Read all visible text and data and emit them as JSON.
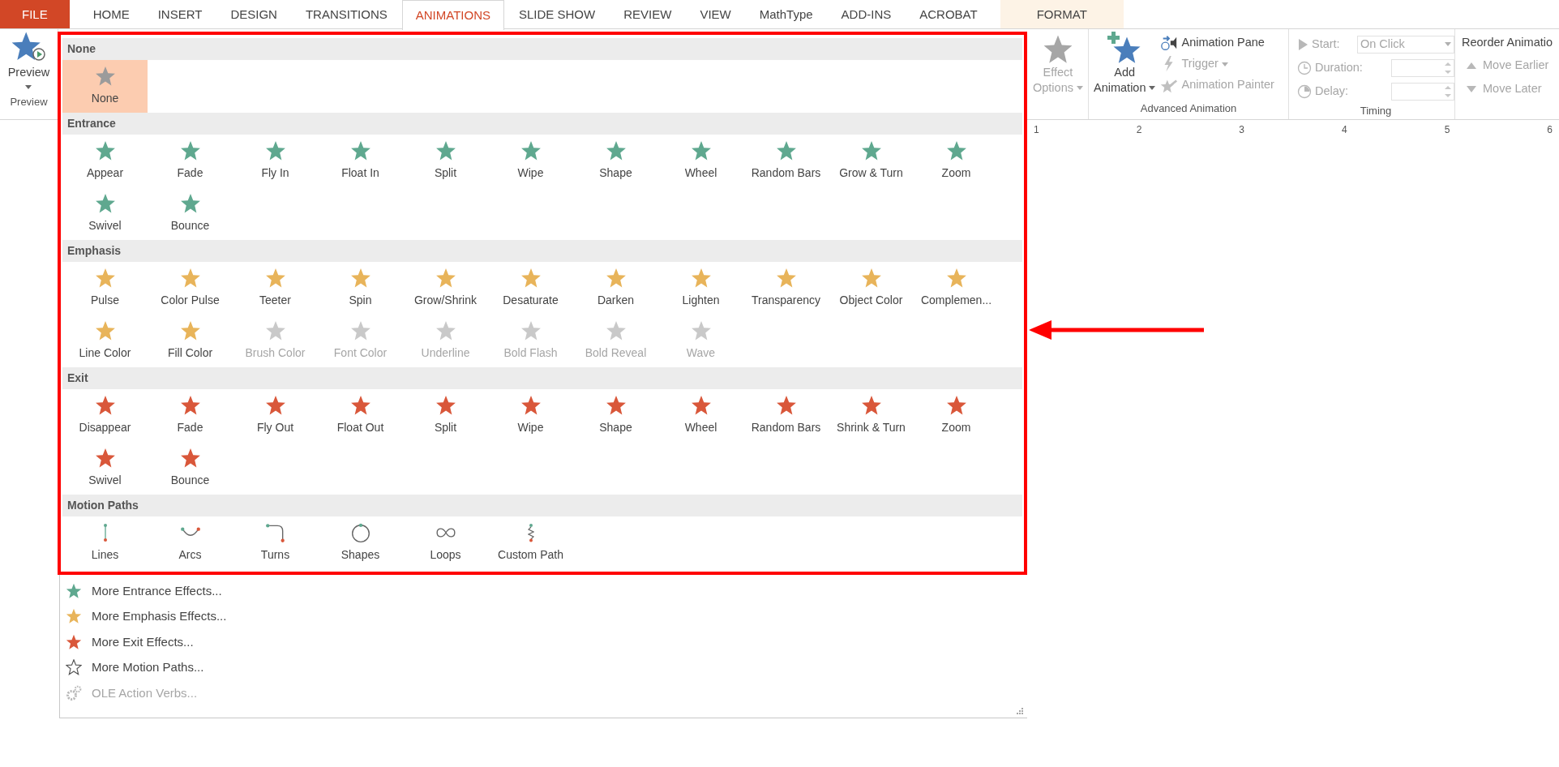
{
  "tabs": [
    {
      "label": "FILE",
      "kind": "file",
      "selected": false
    },
    {
      "label": "HOME",
      "kind": "normal",
      "selected": false
    },
    {
      "label": "INSERT",
      "kind": "normal",
      "selected": false
    },
    {
      "label": "DESIGN",
      "kind": "normal",
      "selected": false
    },
    {
      "label": "TRANSITIONS",
      "kind": "normal",
      "selected": false
    },
    {
      "label": "ANIMATIONS",
      "kind": "normal",
      "selected": true
    },
    {
      "label": "SLIDE SHOW",
      "kind": "normal",
      "selected": false
    },
    {
      "label": "REVIEW",
      "kind": "normal",
      "selected": false
    },
    {
      "label": "VIEW",
      "kind": "normal",
      "selected": false
    },
    {
      "label": "MathType",
      "kind": "normal",
      "selected": false
    },
    {
      "label": "ADD-INS",
      "kind": "normal",
      "selected": false
    },
    {
      "label": "ACROBAT",
      "kind": "normal",
      "selected": false
    },
    {
      "label": "FORMAT",
      "kind": "contextual",
      "selected": false
    }
  ],
  "ribbon": {
    "preview_group": {
      "button": "Preview",
      "label": "Preview"
    },
    "effect_options": {
      "lines": [
        "Effect",
        "Options"
      ],
      "disabled": true
    },
    "advanced_animation": {
      "add_animation": {
        "lines": [
          "Add",
          "Animation"
        ],
        "disabled": false
      },
      "commands": [
        {
          "label": "Animation Pane",
          "kind": "pane",
          "disabled": false,
          "dropdown": false
        },
        {
          "label": "Trigger",
          "kind": "trigger",
          "disabled": true,
          "dropdown": true
        },
        {
          "label": "Animation Painter",
          "kind": "painter",
          "disabled": true,
          "dropdown": false
        }
      ],
      "label": "Advanced Animation"
    },
    "timing": {
      "fields": [
        {
          "label": "Start:",
          "kind": "dropdown",
          "value": "On Click",
          "disabled": true
        },
        {
          "label": "Duration:",
          "kind": "spinner",
          "disabled": true
        },
        {
          "label": "Delay:",
          "kind": "spinner",
          "disabled": true
        }
      ],
      "label": "Timing"
    },
    "reorder": {
      "title": "Reorder Animatio",
      "commands": [
        {
          "label": "Move Earlier",
          "kind": "up",
          "disabled": true
        },
        {
          "label": "Move Later",
          "kind": "down",
          "disabled": true
        }
      ]
    }
  },
  "ruler": {
    "marks": [
      "1",
      "2",
      "3",
      "4",
      "5",
      "6"
    ]
  },
  "gallery": {
    "sections": [
      {
        "title": "None",
        "kind": "none",
        "items": [
          {
            "label": "None",
            "selected": true,
            "disabled": false
          }
        ]
      },
      {
        "title": "Entrance",
        "kind": "entrance",
        "items": [
          {
            "label": "Appear",
            "selected": false,
            "disabled": false
          },
          {
            "label": "Fade",
            "selected": false,
            "disabled": false
          },
          {
            "label": "Fly In",
            "selected": false,
            "disabled": false
          },
          {
            "label": "Float In",
            "selected": false,
            "disabled": false
          },
          {
            "label": "Split",
            "selected": false,
            "disabled": false
          },
          {
            "label": "Wipe",
            "selected": false,
            "disabled": false
          },
          {
            "label": "Shape",
            "selected": false,
            "disabled": false
          },
          {
            "label": "Wheel",
            "selected": false,
            "disabled": false
          },
          {
            "label": "Random Bars",
            "selected": false,
            "disabled": false
          },
          {
            "label": "Grow & Turn",
            "selected": false,
            "disabled": false
          },
          {
            "label": "Zoom",
            "selected": false,
            "disabled": false
          },
          {
            "label": "Swivel",
            "selected": false,
            "disabled": false
          },
          {
            "label": "Bounce",
            "selected": false,
            "disabled": false
          }
        ]
      },
      {
        "title": "Emphasis",
        "kind": "emphasis",
        "items": [
          {
            "label": "Pulse",
            "selected": false,
            "disabled": false
          },
          {
            "label": "Color Pulse",
            "selected": false,
            "disabled": false
          },
          {
            "label": "Teeter",
            "selected": false,
            "disabled": false
          },
          {
            "label": "Spin",
            "selected": false,
            "disabled": false
          },
          {
            "label": "Grow/Shrink",
            "selected": false,
            "disabled": false
          },
          {
            "label": "Desaturate",
            "selected": false,
            "disabled": false
          },
          {
            "label": "Darken",
            "selected": false,
            "disabled": false
          },
          {
            "label": "Lighten",
            "selected": false,
            "disabled": false
          },
          {
            "label": "Transparency",
            "selected": false,
            "disabled": false
          },
          {
            "label": "Object Color",
            "selected": false,
            "disabled": false
          },
          {
            "label": "Complemen...",
            "selected": false,
            "disabled": false
          },
          {
            "label": "Line Color",
            "selected": false,
            "disabled": false
          },
          {
            "label": "Fill Color",
            "selected": false,
            "disabled": false
          },
          {
            "label": "Brush Color",
            "selected": false,
            "disabled": true
          },
          {
            "label": "Font Color",
            "selected": false,
            "disabled": true
          },
          {
            "label": "Underline",
            "selected": false,
            "disabled": true
          },
          {
            "label": "Bold Flash",
            "selected": false,
            "disabled": true
          },
          {
            "label": "Bold Reveal",
            "selected": false,
            "disabled": true
          },
          {
            "label": "Wave",
            "selected": false,
            "disabled": true
          }
        ]
      },
      {
        "title": "Exit",
        "kind": "exit",
        "items": [
          {
            "label": "Disappear",
            "selected": false,
            "disabled": false
          },
          {
            "label": "Fade",
            "selected": false,
            "disabled": false
          },
          {
            "label": "Fly Out",
            "selected": false,
            "disabled": false
          },
          {
            "label": "Float Out",
            "selected": false,
            "disabled": false
          },
          {
            "label": "Split",
            "selected": false,
            "disabled": false
          },
          {
            "label": "Wipe",
            "selected": false,
            "disabled": false
          },
          {
            "label": "Shape",
            "selected": false,
            "disabled": false
          },
          {
            "label": "Wheel",
            "selected": false,
            "disabled": false
          },
          {
            "label": "Random Bars",
            "selected": false,
            "disabled": false
          },
          {
            "label": "Shrink & Turn",
            "selected": false,
            "disabled": false
          },
          {
            "label": "Zoom",
            "selected": false,
            "disabled": false
          },
          {
            "label": "Swivel",
            "selected": false,
            "disabled": false
          },
          {
            "label": "Bounce",
            "selected": false,
            "disabled": false
          }
        ]
      },
      {
        "title": "Motion Paths",
        "kind": "motion",
        "items": [
          {
            "label": "Lines",
            "kind": "line",
            "selected": false,
            "disabled": false
          },
          {
            "label": "Arcs",
            "kind": "arc",
            "selected": false,
            "disabled": false
          },
          {
            "label": "Turns",
            "kind": "turn",
            "selected": false,
            "disabled": false
          },
          {
            "label": "Shapes",
            "kind": "circle",
            "selected": false,
            "disabled": false
          },
          {
            "label": "Loops",
            "kind": "loop",
            "selected": false,
            "disabled": false
          },
          {
            "label": "Custom Path",
            "kind": "custom",
            "selected": false,
            "disabled": false
          }
        ]
      }
    ]
  },
  "menu": [
    {
      "label": "More Entrance Effects...",
      "kind": "entrance",
      "disabled": false
    },
    {
      "label": "More Emphasis Effects...",
      "kind": "emphasis",
      "disabled": false
    },
    {
      "label": "More Exit Effects...",
      "kind": "exit",
      "disabled": false
    },
    {
      "label": "More Motion Paths...",
      "kind": "motion",
      "disabled": false
    },
    {
      "label": "OLE Action Verbs...",
      "kind": "ole",
      "disabled": true
    }
  ]
}
